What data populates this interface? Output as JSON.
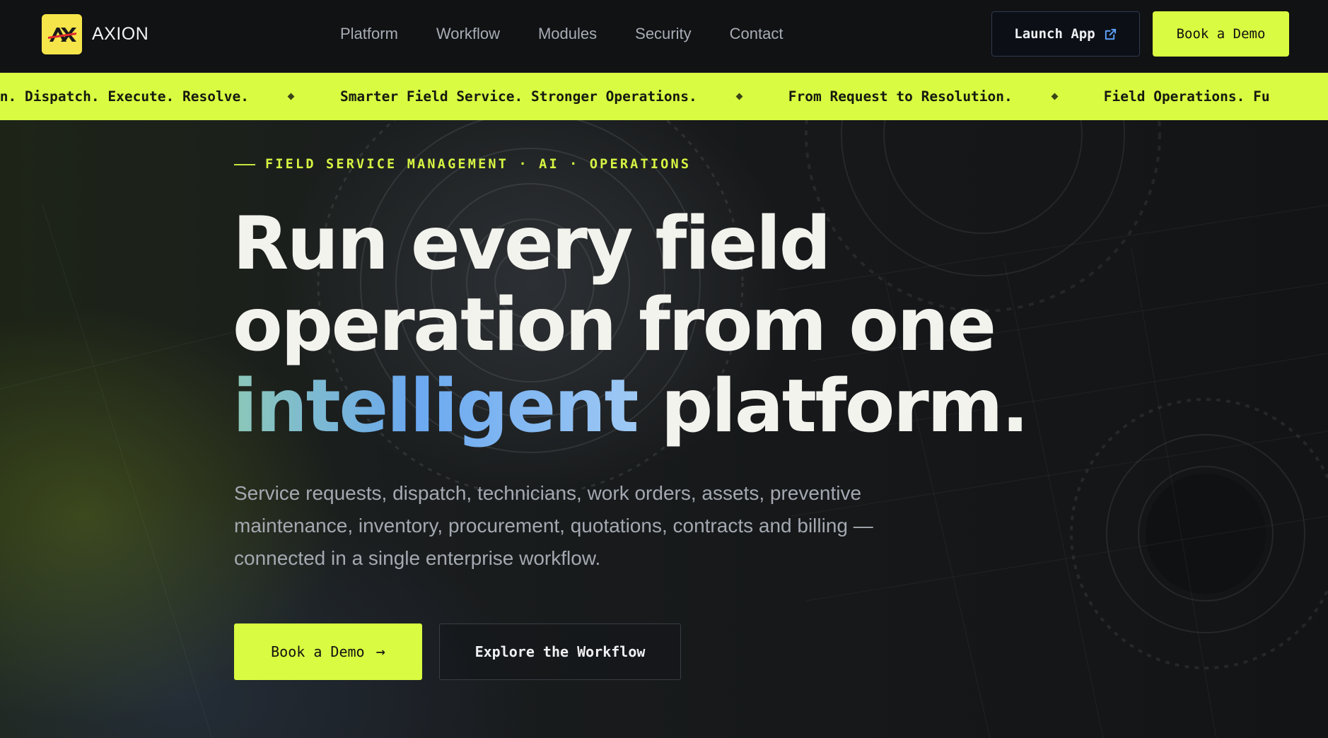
{
  "brand": {
    "name": "AXION",
    "logo_mark": "AX"
  },
  "nav": {
    "links": [
      "Platform",
      "Workflow",
      "Modules",
      "Security",
      "Contact"
    ],
    "launch_label": "Launch App",
    "demo_label": "Book a Demo"
  },
  "ticker": {
    "items": [
      "an. Dispatch. Execute. Resolve.",
      "Smarter Field Service. Stronger Operations.",
      "From Request to Resolution.",
      "Field Operations. Fu"
    ]
  },
  "hero": {
    "eyebrow": "FIELD SERVICE MANAGEMENT · AI · OPERATIONS",
    "headline_line1": "Run every field",
    "headline_line2": "operation from one",
    "headline_highlight": "intelligent",
    "headline_line3_rest": " platform.",
    "subtitle": "Service requests, dispatch, technicians, work orders, assets, preventive maintenance, inventory, procurement, quotations, contracts and billing — connected in a single enterprise workflow.",
    "cta_primary": "Book a Demo",
    "cta_secondary": "Explore the Workflow"
  },
  "colors": {
    "accent": "#d9fb41",
    "nav_bg": "#101214",
    "headline": "#f3f3ee",
    "subtitle": "#a4a9b1",
    "gradient_start": "#8cc8b8",
    "gradient_mid": "#6aa8f0"
  },
  "icons": {
    "launch": "external-link-icon",
    "cta_arrow": "arrow-right-icon",
    "ticker_separator": "diamond-icon"
  }
}
